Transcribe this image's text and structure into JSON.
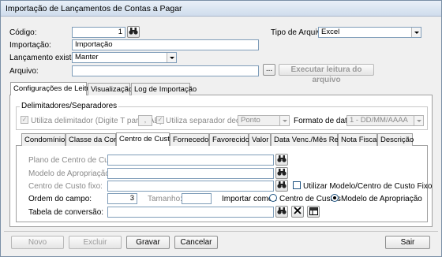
{
  "window": {
    "title": "Importação de Lançamentos de Contas a Pagar"
  },
  "form": {
    "codigo_label": "Código:",
    "codigo_value": "1",
    "tipo_arquivo_label": "Tipo de Arquivo:",
    "tipo_arquivo_value": "Excel",
    "importacao_label": "Importação:",
    "importacao_value": "Importação",
    "lancamento_label": "Lançamento existente:",
    "lancamento_value": "Manter",
    "arquivo_label": "Arquivo:",
    "arquivo_value": "",
    "browse_label": "...",
    "executar_label": "Executar leitura do arquivo"
  },
  "tabs": [
    {
      "label": "Configurações de Leitura"
    },
    {
      "label": "Visualização"
    },
    {
      "label": "Log de Importação"
    }
  ],
  "delimiters": {
    "group_label": "Delimitadores/Separadores",
    "utiliza_delim_label": "Utiliza delimitador (Digite T para TAB)",
    "utiliza_delim_value": ",",
    "utiliza_sep_label": "Utiliza separador decimal",
    "separador_value": "Ponto",
    "formato_label": "Formato de data:",
    "formato_value": "1 - DD/MM/AAAA"
  },
  "subtabs": [
    {
      "label": "Condomínios"
    },
    {
      "label": "Classe da Conta"
    },
    {
      "label": "Centro de Custos"
    },
    {
      "label": "Fornecedor"
    },
    {
      "label": "Favorecido"
    },
    {
      "label": "Valor"
    },
    {
      "label": "Data Venc./Mês Ref."
    },
    {
      "label": "Nota Fiscal"
    },
    {
      "label": "Descrição"
    }
  ],
  "cc": {
    "plano_label": "Plano de Centro de Custos:",
    "modelo_label": "Modelo de Apropriação:",
    "centro_fixo_label": "Centro de Custo fixo:",
    "utilizar_modelo_label": "Utilizar Modelo/Centro de Custo Fixo",
    "ordem_label": "Ordem do campo:",
    "ordem_value": "3",
    "tamanho_label": "Tamanho:",
    "tamanho_value": "",
    "importar_como_label": "Importar como :",
    "radio_centro_label": "Centro de Custos",
    "radio_modelo_label": "Modelo de Apropriação",
    "tabela_label": "Tabela de conversão:",
    "tabela_value": ""
  },
  "buttons": {
    "novo": "Novo",
    "excluir": "Excluir",
    "gravar": "Gravar",
    "cancelar": "Cancelar",
    "sair": "Sair"
  }
}
